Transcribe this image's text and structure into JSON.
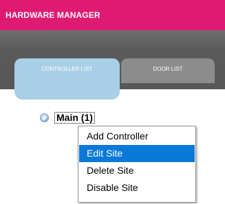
{
  "header": {
    "title": "HARDWARE MANAGER"
  },
  "tabs": [
    {
      "label": "CONTROLLER LIST",
      "active": true
    },
    {
      "label": "DOOR LIST",
      "active": false
    }
  ],
  "tree": {
    "node_label": "Main (1)",
    "node_icon": "check-circle-icon"
  },
  "context_menu": {
    "items": [
      {
        "label": "Add Controller",
        "selected": false
      },
      {
        "label": "Edit Site",
        "selected": true
      },
      {
        "label": "Delete Site",
        "selected": false
      },
      {
        "label": "Disable Site",
        "selected": false
      }
    ]
  },
  "colors": {
    "header_bg": "#e01a73",
    "active_tab": "#a8cfe5",
    "inactive_tab": "#8c8c8c",
    "menu_highlight": "#0a79d8"
  }
}
